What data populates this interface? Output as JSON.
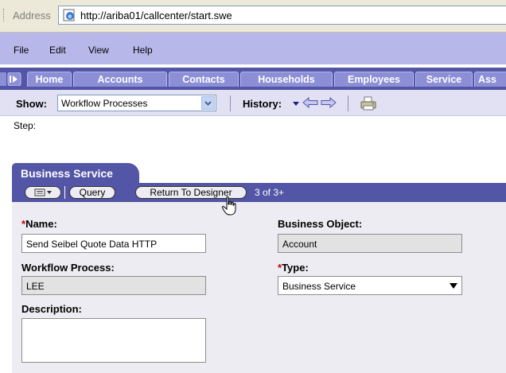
{
  "address_bar": {
    "label": "Address",
    "url": "http://ariba01/callcenter/start.swe"
  },
  "menu": [
    "File",
    "Edit",
    "View",
    "Help"
  ],
  "tabs": [
    "Home",
    "Accounts",
    "Contacts",
    "Households",
    "Employees",
    "Service",
    "Ass"
  ],
  "show_bar": {
    "label": "Show:",
    "selected": "Workflow Processes",
    "history_label": "History:"
  },
  "step_label": "Step:",
  "applet": {
    "title": "Business Service",
    "buttons": {
      "query": "Query",
      "return_to_designer": "Return To Designer"
    },
    "record_count": "3 of 3+"
  },
  "form": {
    "name": {
      "required_mark": "*",
      "label": "Name:",
      "value": "Send Seibel Quote Data HTTP"
    },
    "business_object": {
      "label": "Business Object:",
      "value": "Account"
    },
    "workflow_process": {
      "label": "Workflow Process:",
      "value": "LEE"
    },
    "type": {
      "required_mark": "*",
      "label": "Type:",
      "value": "Business Service"
    },
    "description": {
      "label": "Description:",
      "value": ""
    }
  },
  "colors": {
    "accent": "#5355a6",
    "tab": "#8c8ed6",
    "menubar": "#b7b8e9",
    "required": "#cc0000"
  }
}
